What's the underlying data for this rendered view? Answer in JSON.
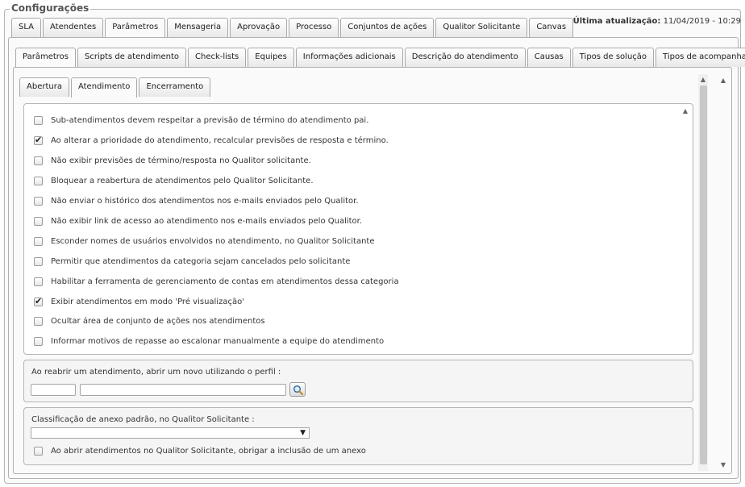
{
  "page": {
    "legend": "Configurações"
  },
  "last_update": {
    "label": "Última atualização:",
    "value": "11/04/2019 - 10:29"
  },
  "main_tabs": [
    {
      "label": "SLA"
    },
    {
      "label": "Atendentes"
    },
    {
      "label": "Parâmetros",
      "active": true
    },
    {
      "label": "Mensageria"
    },
    {
      "label": "Aprovação"
    },
    {
      "label": "Processo"
    },
    {
      "label": "Conjuntos de ações"
    },
    {
      "label": "Qualitor Solicitante"
    },
    {
      "label": "Canvas"
    }
  ],
  "sub_tabs": [
    {
      "label": "Parâmetros",
      "active": true
    },
    {
      "label": "Scripts de atendimento"
    },
    {
      "label": "Check-lists"
    },
    {
      "label": "Equipes"
    },
    {
      "label": "Informações adicionais"
    },
    {
      "label": "Descrição do atendimento"
    },
    {
      "label": "Causas"
    },
    {
      "label": "Tipos de solução"
    },
    {
      "label": "Tipos de acompanhamento"
    }
  ],
  "inner_tabs": [
    {
      "label": "Abertura"
    },
    {
      "label": "Atendimento",
      "active": true
    },
    {
      "label": "Encerramento"
    }
  ],
  "options": [
    {
      "label": "Sub-atendimentos devem respeitar a previsão de término do atendimento pai.",
      "checked": false
    },
    {
      "label": "Ao alterar a prioridade do atendimento, recalcular previsões de resposta e término.",
      "checked": true
    },
    {
      "label": "Não exibir previsões de término/resposta no Qualitor solicitante.",
      "checked": false
    },
    {
      "label": "Bloquear a reabertura de atendimentos pelo Qualitor Solicitante.",
      "checked": false
    },
    {
      "label": "Não enviar o histórico dos atendimentos nos e-mails enviados pelo Qualitor.",
      "checked": false
    },
    {
      "label": "Não exibir link de acesso ao atendimento nos e-mails enviados pelo Qualitor.",
      "checked": false
    },
    {
      "label": "Esconder nomes de usuários envolvidos no atendimento, no Qualitor Solicitante",
      "checked": false
    },
    {
      "label": "Permitir que atendimentos da categoria sejam cancelados pelo solicitante",
      "checked": false
    },
    {
      "label": "Habilitar a ferramenta de gerenciamento de contas em atendimentos dessa categoria",
      "checked": false
    },
    {
      "label": "Exibir atendimentos em modo 'Pré visualização'",
      "checked": true
    },
    {
      "label": "Ocultar área de conjunto de ações nos atendimentos",
      "checked": false
    },
    {
      "label": "Informar motivos de repasse ao escalonar manualmente a equipe do atendimento",
      "checked": false
    }
  ],
  "reopen": {
    "label": "Ao reabrir um atendimento, abrir um novo utilizando o perfil :",
    "code_value": "",
    "name_value": "",
    "lookup_icon": "search-icon"
  },
  "attachment": {
    "label": "Classificação de anexo padrão, no Qualitor Solicitante :",
    "selected": "",
    "require_label": "Ao abrir atendimentos no Qualitor Solicitante, obrigar a inclusão de um anexo",
    "require_checked": false
  }
}
